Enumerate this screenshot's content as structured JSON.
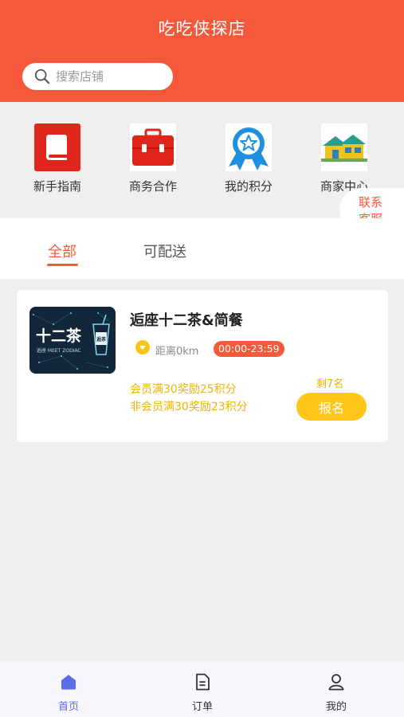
{
  "header": {
    "title": "吃吃侠探店"
  },
  "search": {
    "placeholder": "搜索店铺"
  },
  "quick_nav": [
    {
      "label": "新手指南",
      "icon": "guide-book-icon"
    },
    {
      "label": "商务合作",
      "icon": "briefcase-icon"
    },
    {
      "label": "我的积分",
      "icon": "medal-star-icon"
    },
    {
      "label": "商家中心",
      "icon": "shops-icon"
    }
  ],
  "contact_service": {
    "line1": "联系",
    "line2": "客服"
  },
  "tabs": [
    {
      "label": "全部",
      "active": true
    },
    {
      "label": "可配送",
      "active": false
    }
  ],
  "stores": [
    {
      "name": "逅座十二茶&简餐",
      "image_text": "十二茶",
      "image_subtext": "逅座 MEET ZODIAC",
      "cup_text": "逅茶",
      "distance": "距离0km",
      "hours": "00:00-23:59",
      "reward_member": "会员满30奖励25积分",
      "reward_nonmember": "非会员满30奖励23积分",
      "remaining": "剩7名",
      "signup_label": "报名"
    }
  ],
  "tabbar": [
    {
      "label": "首页",
      "icon": "home-icon",
      "active": true
    },
    {
      "label": "订单",
      "icon": "order-document-icon",
      "active": false
    },
    {
      "label": "我的",
      "icon": "user-profile-icon",
      "active": false
    }
  ],
  "colors": {
    "brand": "#f5593a",
    "accent_yellow": "#ffc61a",
    "reward_text": "#f0b400",
    "tab_active": "#5b6ee8",
    "background": "#efefef"
  }
}
